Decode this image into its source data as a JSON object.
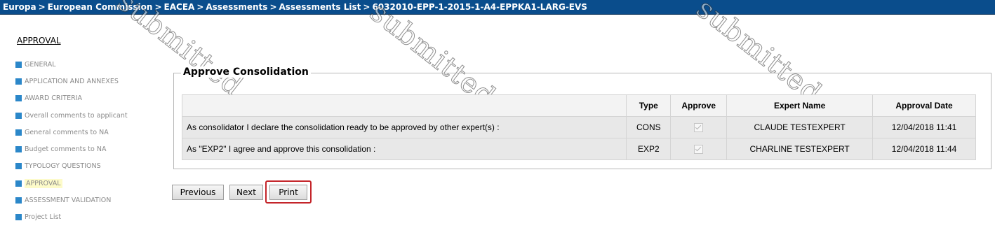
{
  "breadcrumb": {
    "items": [
      "Europa",
      "European Commission",
      "EACEA",
      "Assessments",
      "Assessments List",
      "6032010-EPP-1-2015-1-A4-EPPKA1-LARG-EVS"
    ],
    "separator": ">"
  },
  "sidebar": {
    "title": "APPROVAL",
    "items": [
      {
        "label": "GENERAL"
      },
      {
        "label": "APPLICATION AND ANNEXES"
      },
      {
        "label": "AWARD CRITERIA"
      },
      {
        "label": "Overall comments to applicant"
      },
      {
        "label": "General comments to NA"
      },
      {
        "label": "Budget comments to NA"
      },
      {
        "label": "TYPOLOGY QUESTIONS"
      },
      {
        "label": "APPROVAL"
      },
      {
        "label": "ASSESSMENT VALIDATION"
      },
      {
        "label": "Project List"
      }
    ],
    "active_index": 7
  },
  "panel": {
    "title": "Approve Consolidation",
    "columns": [
      "",
      "Type",
      "Approve",
      "Expert Name",
      "Approval Date"
    ],
    "rows": [
      {
        "statement": "As consolidator I declare the consolidation ready to be approved by other expert(s) :",
        "type": "CONS",
        "approved": true,
        "expert": "CLAUDE TESTEXPERT",
        "date": "12/04/2018 11:41"
      },
      {
        "statement": "As \"EXP2\" I agree and approve this consolidation :",
        "type": "EXP2",
        "approved": true,
        "expert": "CHARLINE TESTEXPERT",
        "date": "12/04/2018 11:44"
      }
    ]
  },
  "buttons": {
    "previous": "Previous",
    "next": "Next",
    "print": "Print"
  },
  "watermark": "submitted",
  "colors": {
    "header_bg": "#0a4d8c",
    "nav_bullet": "#2b87c9",
    "active_nav_bg": "#fdfbc9",
    "highlight": "#c4252a"
  }
}
